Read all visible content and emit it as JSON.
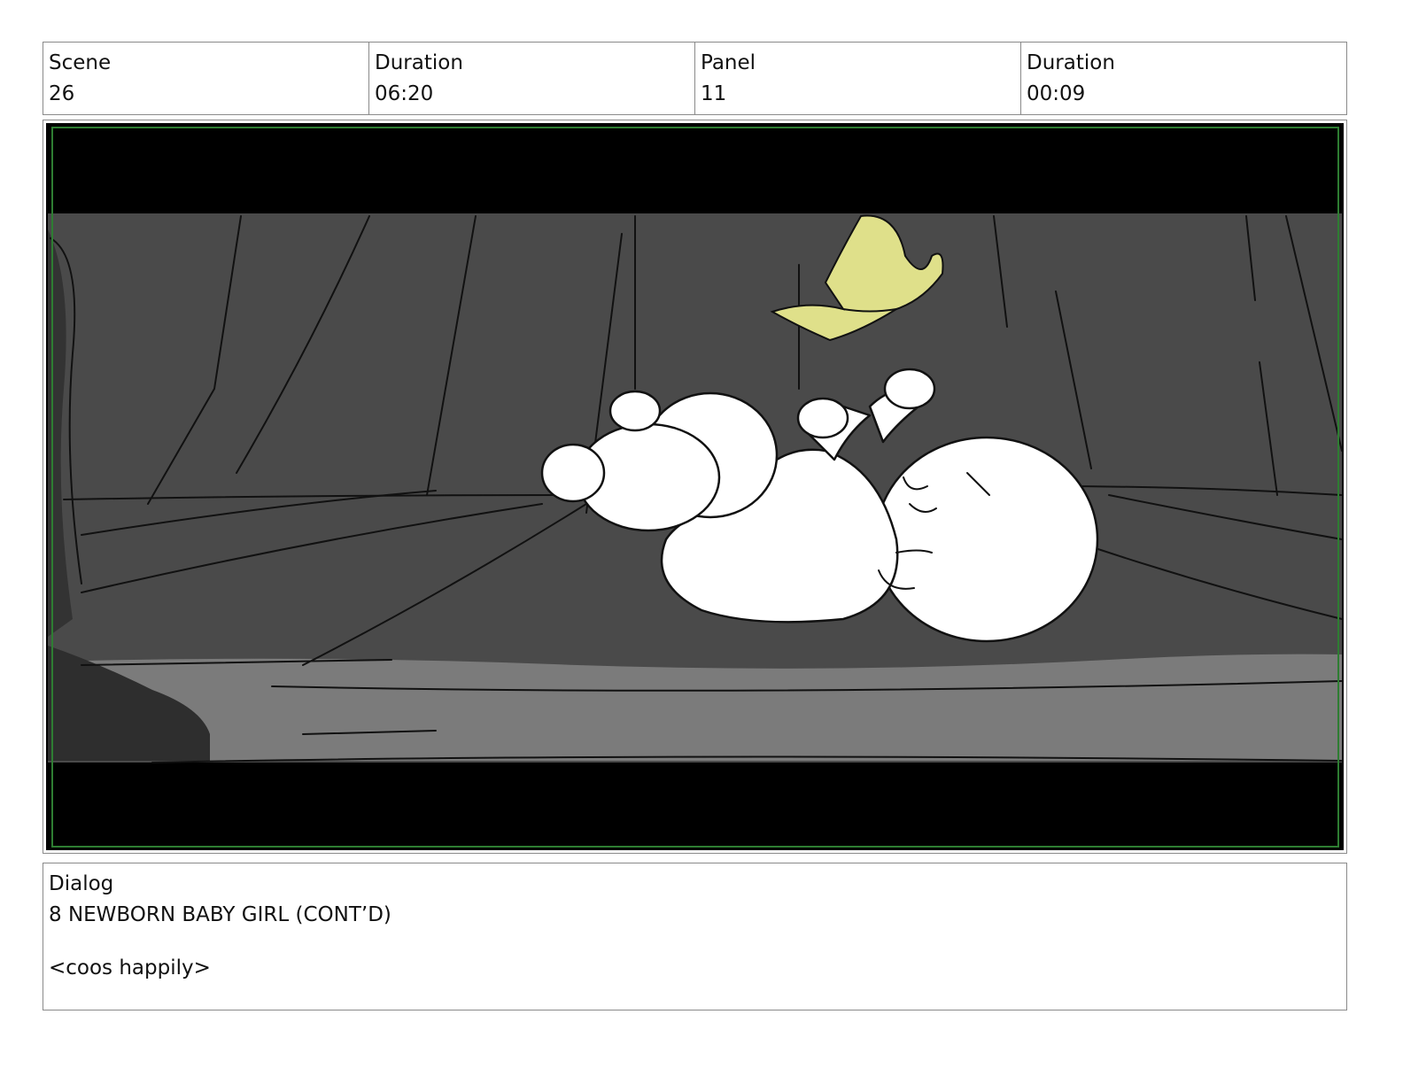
{
  "header": {
    "scene_label": "Scene",
    "scene_value": "26",
    "scene_duration_label": "Duration",
    "scene_duration_value": "06:20",
    "panel_label": "Panel",
    "panel_value": "11",
    "panel_duration_label": "Duration",
    "panel_duration_value": "00:09"
  },
  "dialog": {
    "label": "Dialog",
    "speaker": "8 NEWBORN BABY GIRL (CONT’D)",
    "line": "<coos happily>"
  },
  "colors": {
    "frame_border": "#8a8a8a",
    "safe_area": "#2e7d32",
    "letterbox": "#000000",
    "background_dark": "#4a4a4a",
    "floor_light": "#7b7b7b",
    "butterfly": "#dfe08a",
    "baby": "#ffffff"
  }
}
